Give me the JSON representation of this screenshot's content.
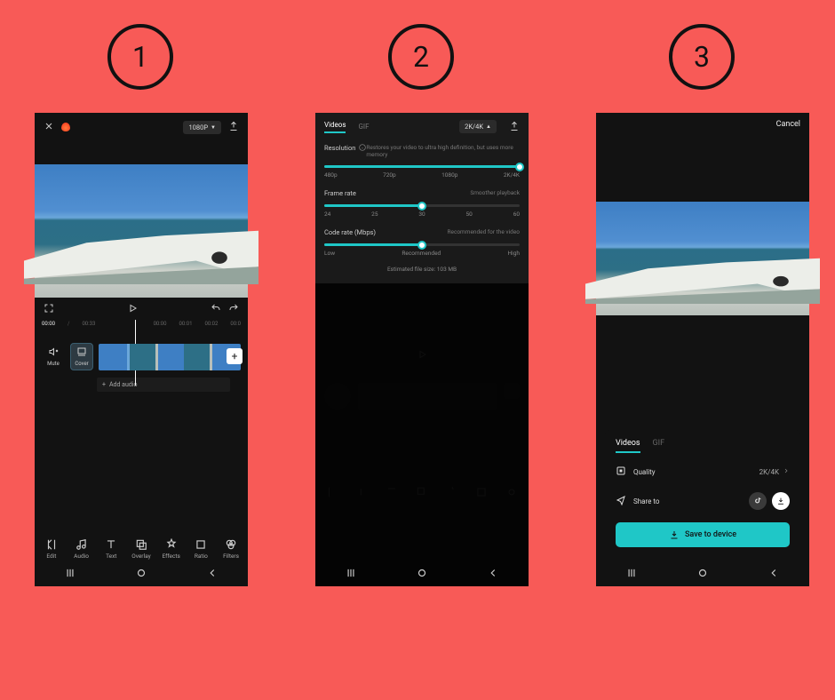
{
  "steps": {
    "one": "1",
    "two": "2",
    "three": "3"
  },
  "panel1": {
    "resolution_pill": "1080P",
    "time_current": "00:00",
    "time_total": "00:33",
    "ruler": [
      "00:00",
      "00:01",
      "00:02",
      "00:0"
    ],
    "mute": "Mute",
    "cover": "Cover",
    "add_audio": "Add audio",
    "tools": [
      {
        "label": "Edit"
      },
      {
        "label": "Audio"
      },
      {
        "label": "Text"
      },
      {
        "label": "Overlay"
      },
      {
        "label": "Effects"
      },
      {
        "label": "Ratio"
      },
      {
        "label": "Filters"
      }
    ]
  },
  "panel2": {
    "tab_videos": "Videos",
    "tab_gif": "GIF",
    "pill": "2K/4K",
    "resolution": {
      "label": "Resolution",
      "hint": "Restores your video to ultra high definition, but uses more memory",
      "options": [
        "480p",
        "720p",
        "1080p",
        "2K/4K"
      ],
      "fill_pct": 100
    },
    "framerate": {
      "label": "Frame rate",
      "hint": "Smoother playback",
      "options": [
        "24",
        "25",
        "30",
        "50",
        "60"
      ],
      "fill_pct": 50
    },
    "coderate": {
      "label": "Code rate (Mbps)",
      "hint": "Recommended for the video",
      "options": [
        "Low",
        "Recommended",
        "High"
      ],
      "fill_pct": 50
    },
    "estimate": "Estimated file size: 103 MB"
  },
  "panel3": {
    "cancel": "Cancel",
    "tab_videos": "Videos",
    "tab_gif": "GIF",
    "quality_label": "Quality",
    "quality_value": "2K/4K",
    "share_label": "Share to",
    "save_button": "Save to device"
  }
}
